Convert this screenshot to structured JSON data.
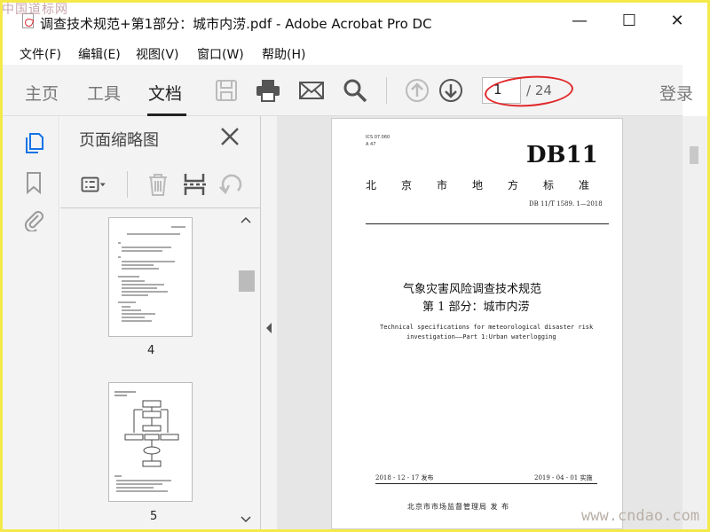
{
  "watermark": {
    "logo_text": "中国道标网",
    "site": "www.cndao.com"
  },
  "window": {
    "title": "调查技术规范+第1部分：城市内涝.pdf - Adobe Acrobat Pro DC"
  },
  "menu": [
    "文件(F)",
    "编辑(E)",
    "视图(V)",
    "窗口(W)",
    "帮助(H)"
  ],
  "toolbar": {
    "tabs": [
      "主页",
      "工具",
      "文档"
    ],
    "active_tab": "文档",
    "page_current": "1",
    "page_total": "/ 24",
    "login": "登录",
    "icons": [
      "save-icon",
      "print-icon",
      "mail-icon",
      "search-icon",
      "page-up-icon",
      "page-down-icon"
    ]
  },
  "thumbnails_panel": {
    "title": "页面缩略图",
    "pages": [
      {
        "label": "4"
      },
      {
        "label": "5"
      }
    ]
  },
  "document": {
    "ics": "ICS 07.060",
    "ccs": "A 47",
    "code": "DB11",
    "standard_type": "北京市地方标准",
    "number": "DB 11/T 1589. 1—2018",
    "title_cn_1": "气象灾害风险调查技术规范",
    "title_cn_2": "第 1 部分：城市内涝",
    "title_en_1": "Technical specifications for meteorological disaster risk",
    "title_en_2": "investigation——Part 1:Urban waterlogging",
    "publish_date": "2018 - 12 - 17 发布",
    "implement_date": "2019 - 04 - 01 实施",
    "issuer": "北京市市场监督管理局      发 布"
  },
  "colors": {
    "annotation": "#e0282a",
    "toolbar_bg": "#f3f3f3"
  }
}
